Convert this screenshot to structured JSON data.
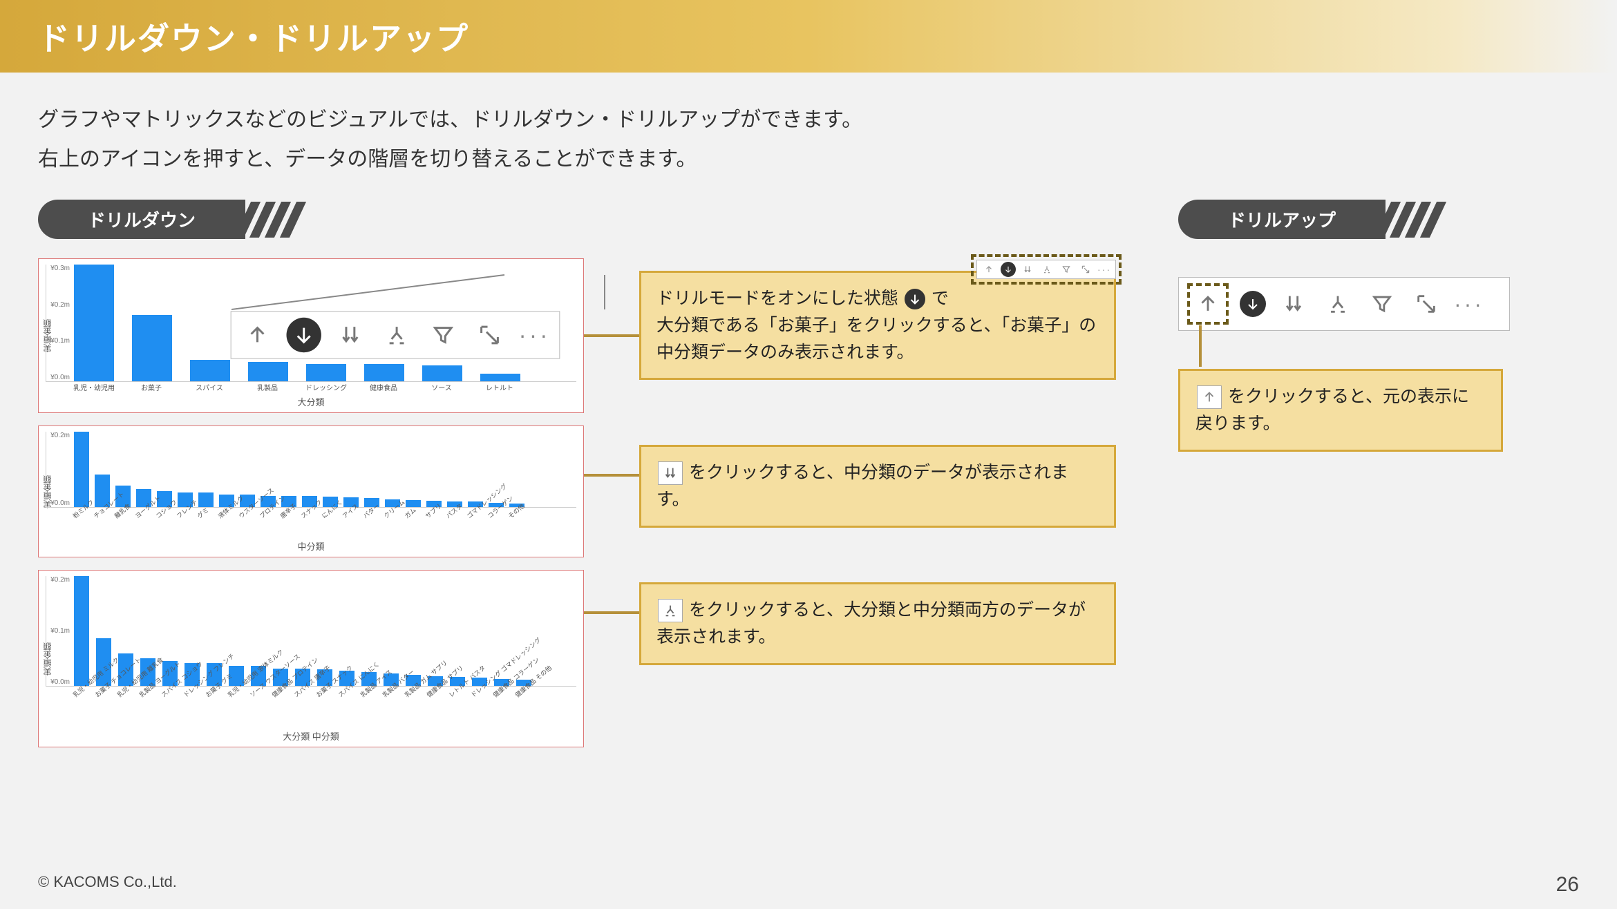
{
  "title": "ドリルダウン・ドリルアップ",
  "intro_line1": "グラフやマトリックスなどのビジュアルでは、ドリルダウン・ドリルアップができます。",
  "intro_line2": "右上のアイコンを押すと、データの階層を切り替えることができます。",
  "section_left": "ドリルダウン",
  "section_right": "ドリルアップ",
  "callouts": {
    "c1a": "ドリルモードをオンにした状態",
    "c1b": "で",
    "c1c": "大分類である「お菓子」をクリックすると、「お菓子」の中分類データのみ表示されます。",
    "c2a": "をクリックすると、中分類のデータが表示されます。",
    "c3a": "をクリックすると、大分類と中分類両方のデータが表示されます。",
    "c4a": "をクリックすると、元の表示に戻ります。"
  },
  "footer": "© KACOMS Co.,Ltd.",
  "page": "26",
  "chart_data": [
    {
      "type": "bar",
      "title": "",
      "xlabel": "大分類",
      "ylabel": "実績金額",
      "yticks": [
        "¥0.3m",
        "¥0.2m",
        "¥0.1m",
        "¥0.0m"
      ],
      "categories": [
        "乳児・幼児用",
        "お菓子",
        "スパイス",
        "乳製品",
        "ドレッシング",
        "健康食品",
        "ソース",
        "レトルト"
      ],
      "values": [
        0.3,
        0.17,
        0.055,
        0.05,
        0.045,
        0.045,
        0.04,
        0.02
      ],
      "ylim": [
        0,
        0.3
      ]
    },
    {
      "type": "bar",
      "title": "",
      "xlabel": "中分類",
      "ylabel": "実績金額",
      "yticks": [
        "¥0.2m",
        "¥0.0m"
      ],
      "categories": [
        "粉ミルク",
        "チョコレート",
        "離乳食",
        "ヨーグルト",
        "コショウ",
        "フレンチ",
        "グミ",
        "液体ミルク",
        "ウスターソース",
        "プロテイン",
        "唐辛子",
        "スナック",
        "にんにく",
        "アイス",
        "バター",
        "クリーム",
        "ガム",
        "サプリ",
        "パスタ",
        "ゴマドレッシング",
        "コラーゲン",
        "その他"
      ],
      "values": [
        0.21,
        0.09,
        0.06,
        0.05,
        0.045,
        0.04,
        0.04,
        0.035,
        0.035,
        0.03,
        0.03,
        0.03,
        0.028,
        0.027,
        0.025,
        0.022,
        0.02,
        0.018,
        0.015,
        0.015,
        0.012,
        0.01
      ],
      "ylim": [
        0,
        0.21
      ]
    },
    {
      "type": "bar",
      "title": "",
      "xlabel": "大分類 中分類",
      "ylabel": "実績金額",
      "yticks": [
        "¥0.2m",
        "¥0.1m",
        "¥0.0m"
      ],
      "categories": [
        "乳児・幼児用 ミルク",
        "お菓子 チョコレート",
        "乳児・幼児用 離乳食",
        "乳製品 ヨーグルト",
        "スパイス コショウ",
        "ドレッシング フレンチ",
        "お菓子 グミ",
        "乳児・幼児用 液体ミルク",
        "ソース ウスターソース",
        "健康食品 プロテイン",
        "スパイス 唐辛子",
        "お菓子 スナック",
        "スパイス にんにく",
        "乳製品 アイス",
        "乳製品 バター",
        "乳製品 ガム サプリ",
        "健康食品 サプリ",
        "レトルト パスタ",
        "ドレッシング ゴマドレッシング",
        "健康食品 コラーゲン",
        "健康食品 その他"
      ],
      "values": [
        0.22,
        0.095,
        0.065,
        0.055,
        0.05,
        0.045,
        0.045,
        0.04,
        0.04,
        0.035,
        0.035,
        0.033,
        0.03,
        0.028,
        0.025,
        0.022,
        0.02,
        0.018,
        0.016,
        0.014,
        0.012
      ],
      "ylim": [
        0,
        0.22
      ]
    }
  ]
}
